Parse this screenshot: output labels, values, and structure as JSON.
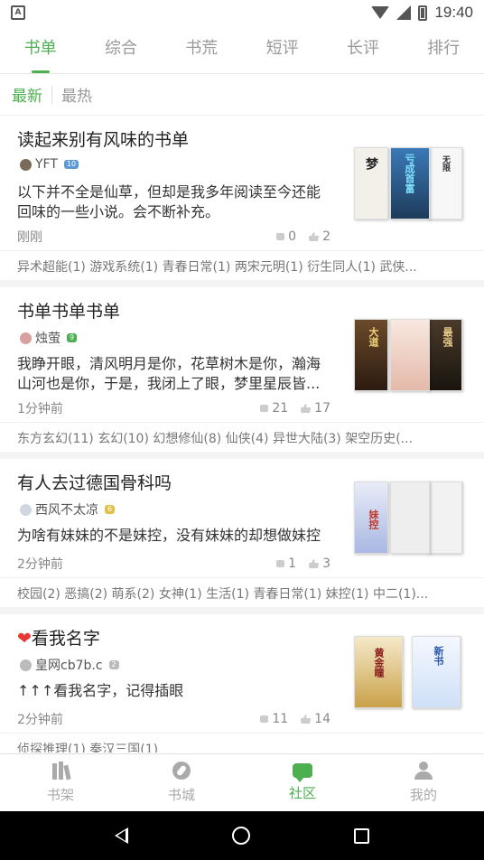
{
  "status_bar": {
    "time": "19:40",
    "app_icon": "A"
  },
  "top_tabs": [
    {
      "label": "书单",
      "active": true
    },
    {
      "label": "综合",
      "active": false
    },
    {
      "label": "书荒",
      "active": false
    },
    {
      "label": "短评",
      "active": false
    },
    {
      "label": "长评",
      "active": false
    },
    {
      "label": "排行",
      "active": false
    }
  ],
  "sort": {
    "latest": "最新",
    "hottest": "最热"
  },
  "cards": [
    {
      "title": "读起来别有风味的书单",
      "author": "YFT",
      "level": "10",
      "level_color": "#5b9bd5",
      "desc_lines": [
        "以下并不全是仙草，但却是我多年阅读至今还能",
        "回味的一些小说。会不断补充。"
      ],
      "time": "刚刚",
      "comments": "0",
      "likes": "2",
      "tags": "异术超能(1) 游戏系统(1) 青春日常(1) 两宋元明(1) 衍生同人(1) 武侠..."
    },
    {
      "title": "书单书单书单",
      "author": "烛萤",
      "level": "9",
      "level_color": "#4caf50",
      "desc_lines": [
        "我睁开眼，清风明月是你，花草树木是你，瀚海",
        "山河也是你，于是，我闭上了眼，梦里星辰皆..."
      ],
      "time": "1分钟前",
      "comments": "21",
      "likes": "17",
      "tags": "东方玄幻(11) 玄幻(10) 幻想修仙(8) 仙侠(4) 异世大陆(3) 架空历史(..."
    },
    {
      "title": "有人去过德国骨科吗",
      "author": "西风不太凉",
      "level": "6",
      "level_color": "#e2c14a",
      "desc_lines": [
        "为啥有妹妹的不是妹控，没有妹妹的却想做妹控"
      ],
      "time": "2分钟前",
      "comments": "1",
      "likes": "3",
      "tags": "校园(2) 恶搞(2) 萌系(2) 女神(1) 生活(1) 青春日常(1) 妹控(1) 中二(1)..."
    },
    {
      "title": "看我名字",
      "title_prefix": "❤",
      "author": "皇网cb7b.c",
      "level": "2",
      "level_color": "#bbbbbb",
      "desc_lines": [
        "↑↑↑看我名字，记得插眼"
      ],
      "time": "2分钟前",
      "comments": "11",
      "likes": "14",
      "tags": "侦探推理(1) 秦汉三国(1)"
    }
  ],
  "bottom_nav": [
    {
      "label": "书架",
      "icon": "bookshelf-icon",
      "active": false
    },
    {
      "label": "书城",
      "icon": "compass-icon",
      "active": false
    },
    {
      "label": "社区",
      "icon": "chat-icon",
      "active": true
    },
    {
      "label": "我的",
      "icon": "user-icon",
      "active": false
    }
  ],
  "colors": {
    "accent": "#4caf50",
    "text": "#222222",
    "muted": "#888888"
  }
}
